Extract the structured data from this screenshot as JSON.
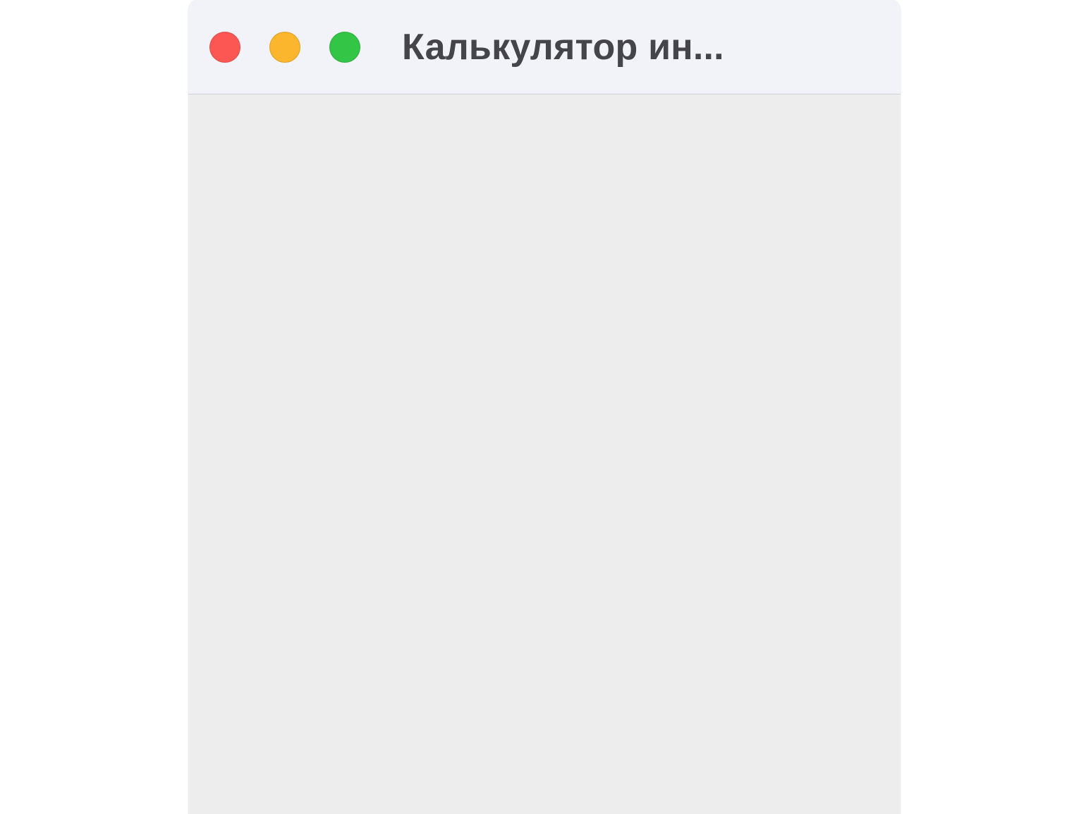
{
  "window": {
    "title": "Калькулятор ин...",
    "traffic_lights": {
      "close_color": "#fd5753",
      "minimize_color": "#fcb62d",
      "zoom_color": "#33c546"
    }
  }
}
